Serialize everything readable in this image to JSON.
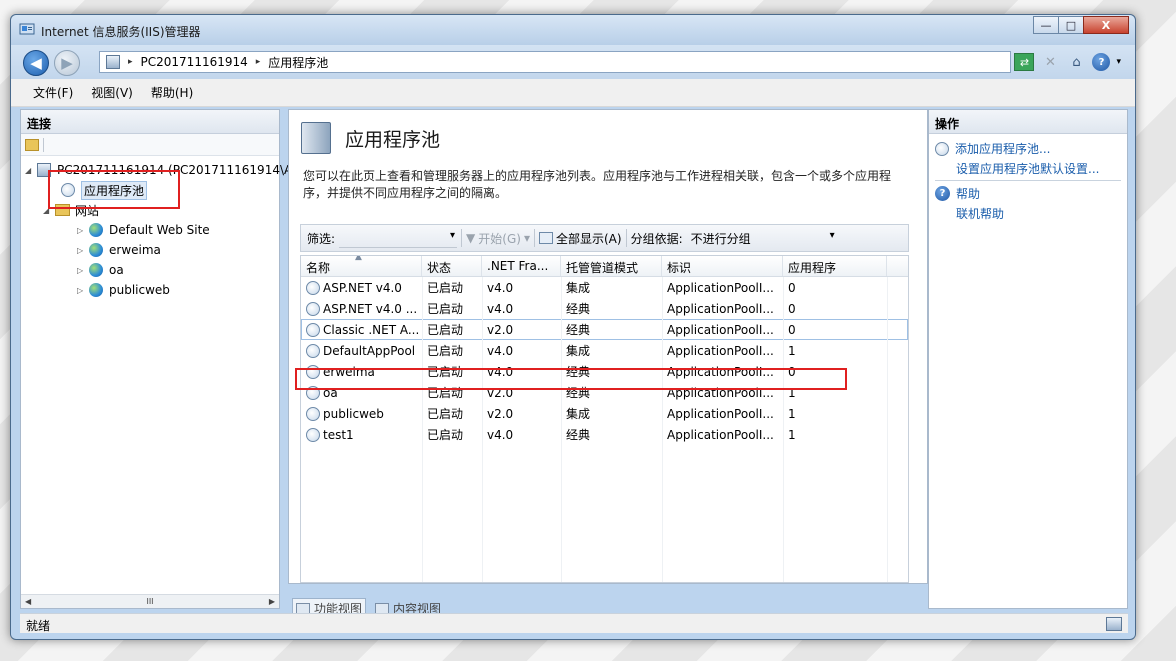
{
  "window": {
    "title": "Internet 信息服务(IIS)管理器",
    "buttons": {
      "minimize": "—",
      "maximize": "□",
      "close": "X"
    }
  },
  "address": {
    "crumbs": [
      "PC201711161914",
      "应用程序池"
    ],
    "arrow": "▸"
  },
  "menu": [
    "文件(F)",
    "视图(V)",
    "帮助(H)"
  ],
  "connections": {
    "header": "连接",
    "tree": {
      "server": "PC201711161914 (PC201711161914\\A",
      "app_pools": "应用程序池",
      "sites": "网站",
      "site_items": [
        "Default Web Site",
        "erweima",
        "oa",
        "publicweb"
      ]
    },
    "scroll_mark": "III"
  },
  "main": {
    "title": "应用程序池",
    "description": "您可以在此页上查看和管理服务器上的应用程序池列表。应用程序池与工作进程相关联，包含一个或多个应用程序，并提供不同应用程序之间的隔离。",
    "filter": {
      "label": "筛选:",
      "start": "开始(G)",
      "show_all": "全部显示(A)",
      "group_label": "分组依据:",
      "group_value": "不进行分组"
    },
    "columns": [
      "名称",
      "状态",
      ".NET Fra...",
      "托管管道模式",
      "标识",
      "应用程序"
    ],
    "rows": [
      [
        "ASP.NET v4.0",
        "已启动",
        "v4.0",
        "集成",
        "ApplicationPoolI...",
        "0"
      ],
      [
        "ASP.NET v4.0 ...",
        "已启动",
        "v4.0",
        "经典",
        "ApplicationPoolI...",
        "0"
      ],
      [
        "Classic .NET A...",
        "已启动",
        "v2.0",
        "经典",
        "ApplicationPoolI...",
        "0"
      ],
      [
        "DefaultAppPool",
        "已启动",
        "v4.0",
        "集成",
        "ApplicationPoolI...",
        "1"
      ],
      [
        "erweima",
        "已启动",
        "v4.0",
        "经典",
        "ApplicationPoolI...",
        "0"
      ],
      [
        "oa",
        "已启动",
        "v2.0",
        "经典",
        "ApplicationPoolI...",
        "1"
      ],
      [
        "publicweb",
        "已启动",
        "v2.0",
        "集成",
        "ApplicationPoolI...",
        "1"
      ],
      [
        "test1",
        "已启动",
        "v4.0",
        "经典",
        "ApplicationPoolI...",
        "1"
      ]
    ],
    "view_tabs": [
      "功能视图",
      "内容视图"
    ]
  },
  "actions": {
    "header": "操作",
    "add_pool": "添加应用程序池...",
    "set_defaults": "设置应用程序池默认设置...",
    "help": "帮助",
    "online_help": "联机帮助"
  },
  "status": "就绪",
  "colors": {
    "highlight": "#e02020",
    "link": "#1a5dab",
    "accent": "#bcd4ee"
  }
}
